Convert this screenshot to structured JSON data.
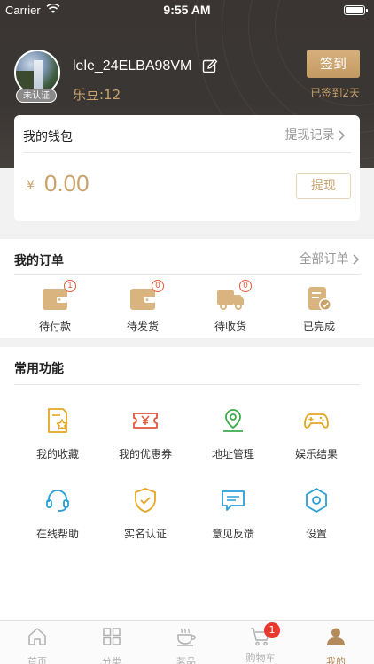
{
  "status_bar": {
    "carrier": "Carrier",
    "time": "9:55 AM"
  },
  "profile": {
    "username": "lele_24ELBA98VM",
    "verify_badge": "未认证",
    "ledou": "乐豆:12",
    "checkin_label": "签到",
    "checkin_days": "已签到2天"
  },
  "wallet": {
    "title": "我的钱包",
    "record_label": "提现记录",
    "currency": "¥",
    "amount": "0.00",
    "withdraw_label": "提现"
  },
  "orders": {
    "title": "我的订单",
    "all_label": "全部订单",
    "items": [
      {
        "label": "待付款",
        "count": "1"
      },
      {
        "label": "待发货",
        "count": "0"
      },
      {
        "label": "待收货",
        "count": "0"
      },
      {
        "label": "已完成",
        "count": ""
      }
    ]
  },
  "functions": {
    "title": "常用功能",
    "items": [
      {
        "label": "我的收藏",
        "icon": "star-doc-icon"
      },
      {
        "label": "我的优惠券",
        "icon": "coupon-icon"
      },
      {
        "label": "地址管理",
        "icon": "location-icon"
      },
      {
        "label": "娱乐结果",
        "icon": "gamepad-icon"
      },
      {
        "label": "在线帮助",
        "icon": "headset-icon"
      },
      {
        "label": "实名认证",
        "icon": "shield-check-icon"
      },
      {
        "label": "意见反馈",
        "icon": "message-icon"
      },
      {
        "label": "设置",
        "icon": "hexagon-gear-icon"
      }
    ]
  },
  "tabbar": {
    "items": [
      {
        "label": "首页",
        "icon": "home-icon"
      },
      {
        "label": "分类",
        "icon": "grid-icon"
      },
      {
        "label": "茗品",
        "icon": "tea-cup-icon"
      },
      {
        "label": "购物车",
        "icon": "cart-icon",
        "badge": "1"
      },
      {
        "label": "我的",
        "icon": "person-icon",
        "active": true
      }
    ]
  },
  "colors": {
    "accent_gold": "#c9a36b",
    "header_bg": "#3a3532",
    "badge_red": "#e8392f"
  }
}
